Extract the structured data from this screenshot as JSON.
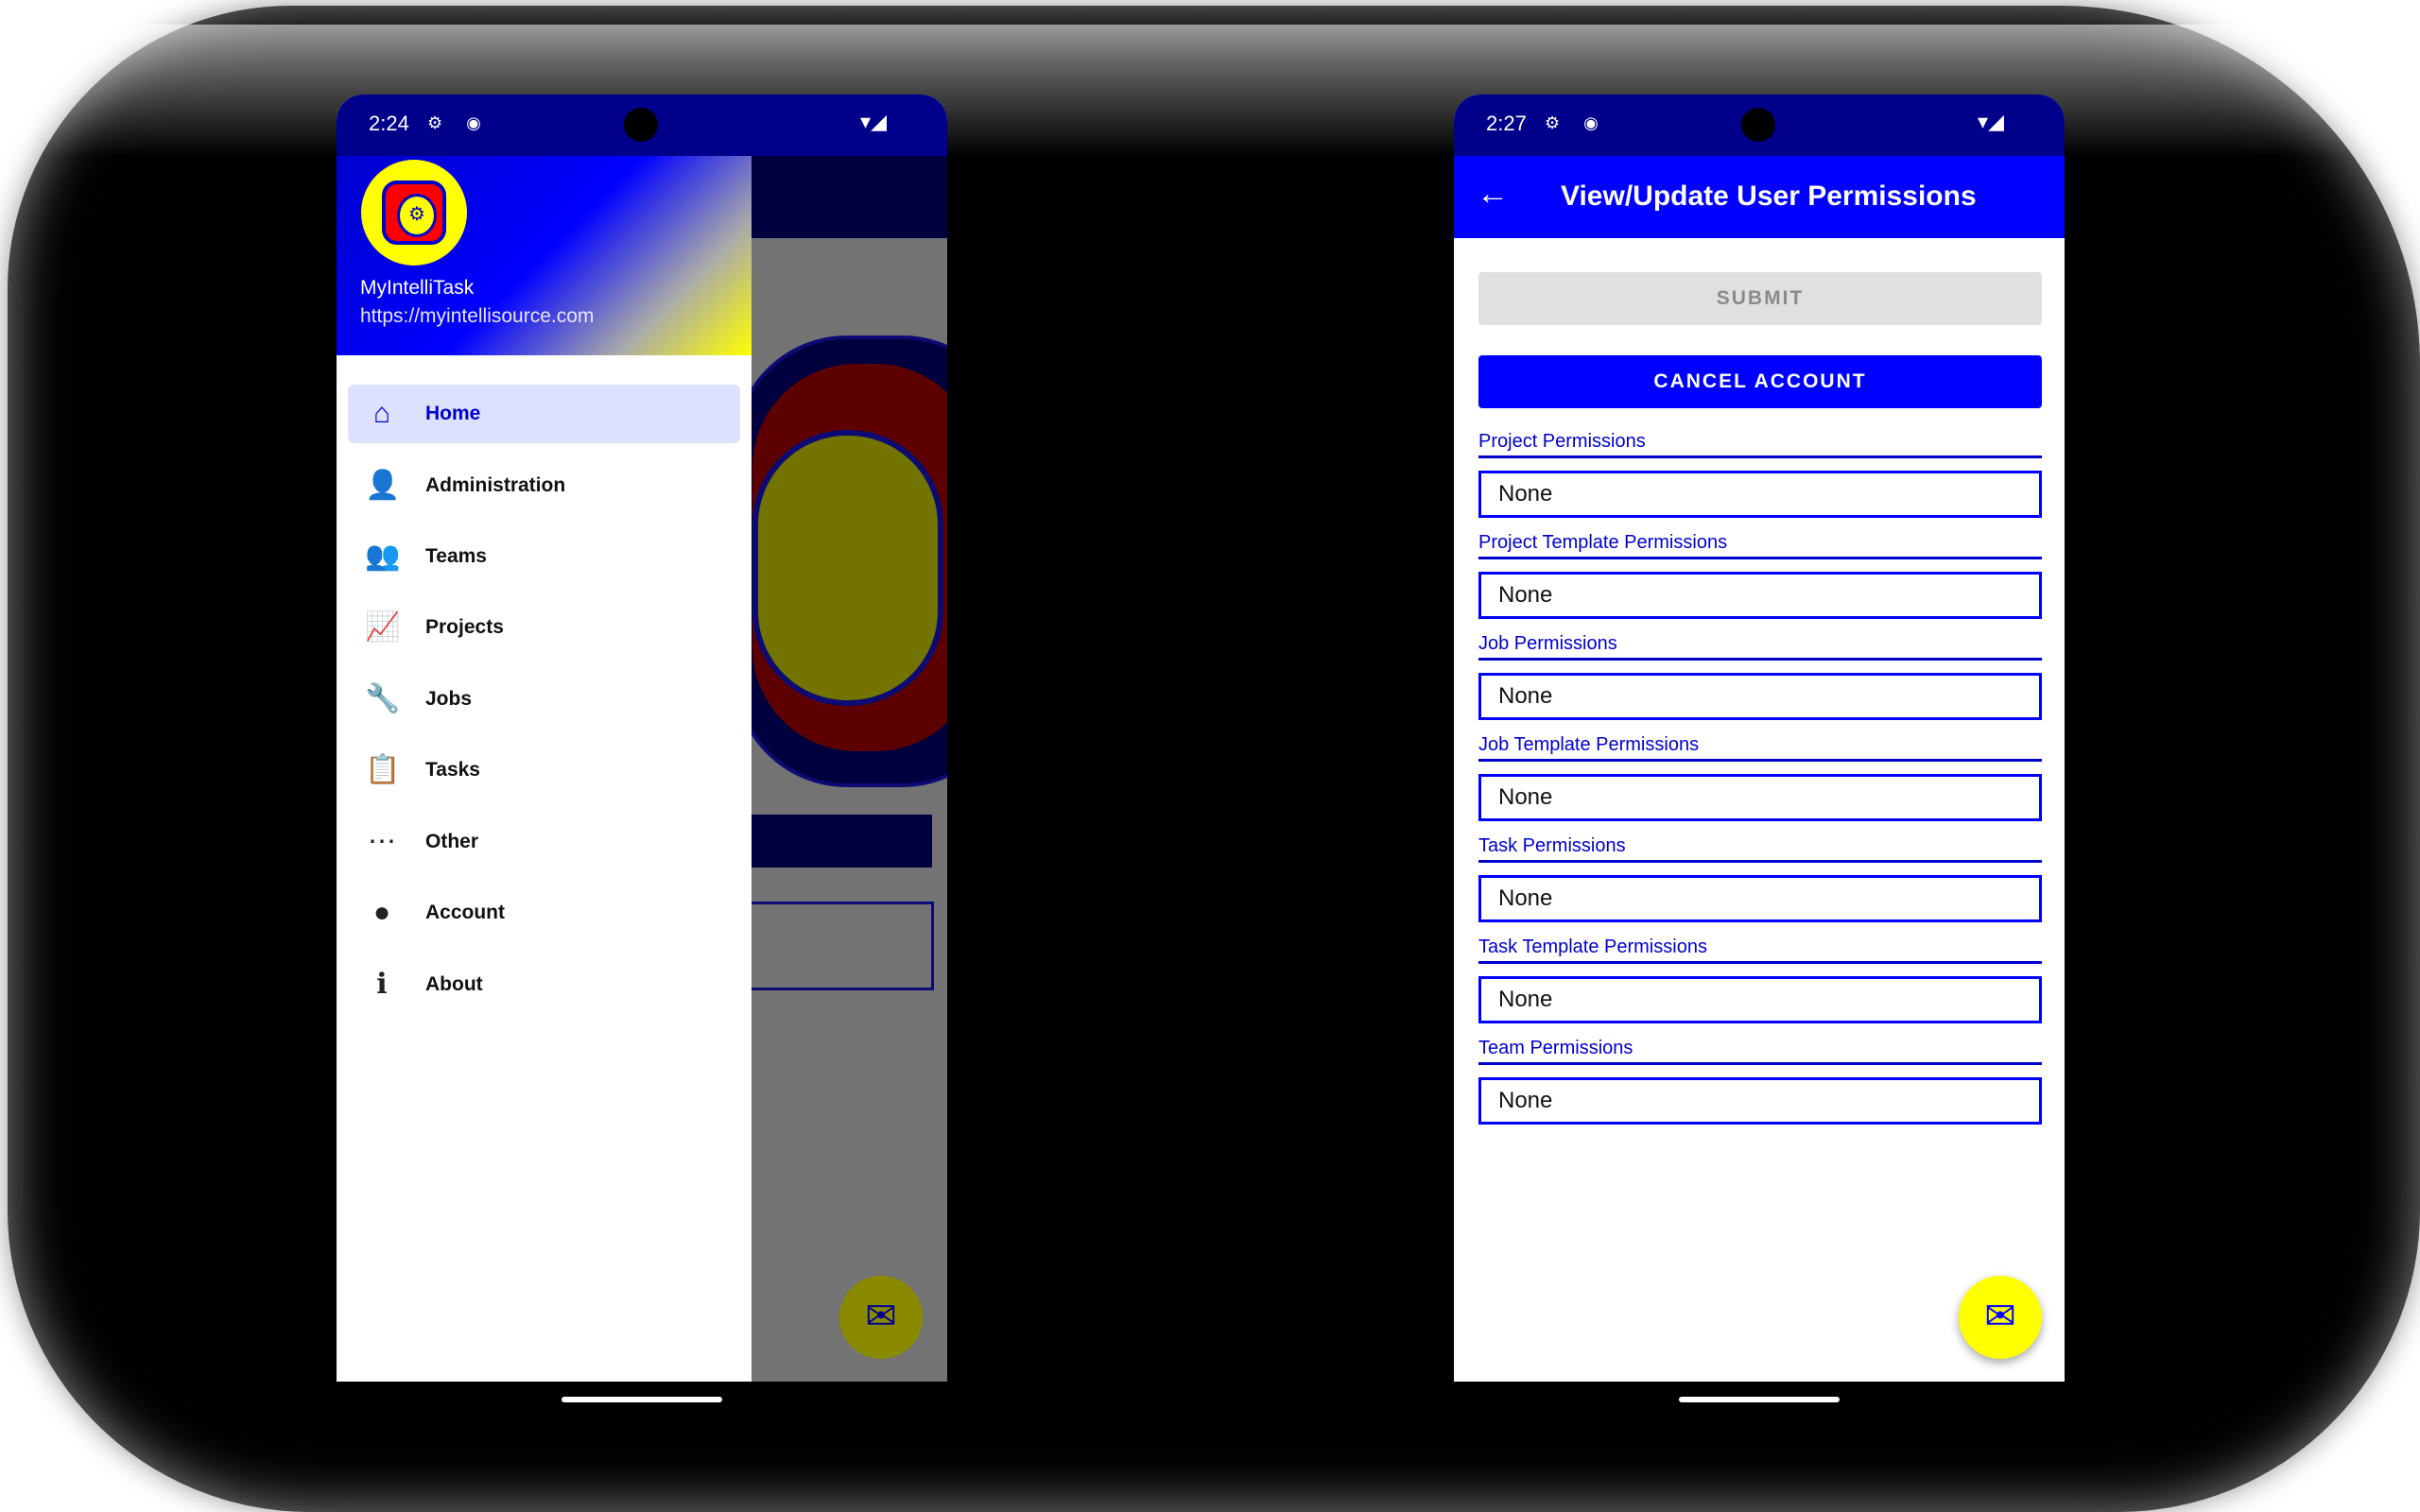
{
  "left_phone": {
    "status_time": "2:24",
    "status_left_icons": "⚙ ◉",
    "status_right_icons": "▾◢",
    "drawer": {
      "app_name": "MyIntelliTask",
      "app_url": "https://myintellisource.com",
      "items": [
        {
          "label": "Home",
          "icon": "home-icon",
          "glyph": "⌂"
        },
        {
          "label": "Administration",
          "icon": "admin-icon",
          "glyph": "👤"
        },
        {
          "label": "Teams",
          "icon": "teams-icon",
          "glyph": "👥"
        },
        {
          "label": "Projects",
          "icon": "projects-icon",
          "glyph": "📈"
        },
        {
          "label": "Jobs",
          "icon": "jobs-icon",
          "glyph": "🔧"
        },
        {
          "label": "Tasks",
          "icon": "tasks-icon",
          "glyph": "📋"
        },
        {
          "label": "Other",
          "icon": "other-icon",
          "glyph": "⋯"
        },
        {
          "label": "Account",
          "icon": "account-icon",
          "glyph": "●"
        },
        {
          "label": "About",
          "icon": "about-icon",
          "glyph": "ℹ"
        }
      ],
      "active_item": "Home"
    },
    "fab_glyph": "✉"
  },
  "right_phone": {
    "status_time": "2:27",
    "status_left_icons": "⚙ ◉",
    "status_right_icons": "▾◢",
    "appbar_title": "View/Update User Permissions",
    "back_glyph": "←",
    "submit_label": "SUBMIT",
    "cancel_label": "CANCEL ACCOUNT",
    "permissions": [
      {
        "label": "Project Permissions",
        "value": "None"
      },
      {
        "label": "Project Template Permissions",
        "value": "None"
      },
      {
        "label": "Job Permissions",
        "value": "None"
      },
      {
        "label": "Job Template Permissions",
        "value": "None"
      },
      {
        "label": "Task Permissions",
        "value": "None"
      },
      {
        "label": "Task Template Permissions",
        "value": "None"
      },
      {
        "label": "Team Permissions",
        "value": "None"
      }
    ],
    "fab_glyph": "✉"
  },
  "colors": {
    "status_bar": "#00008b",
    "accent": "#0000ff",
    "fab": "#ffff00"
  }
}
